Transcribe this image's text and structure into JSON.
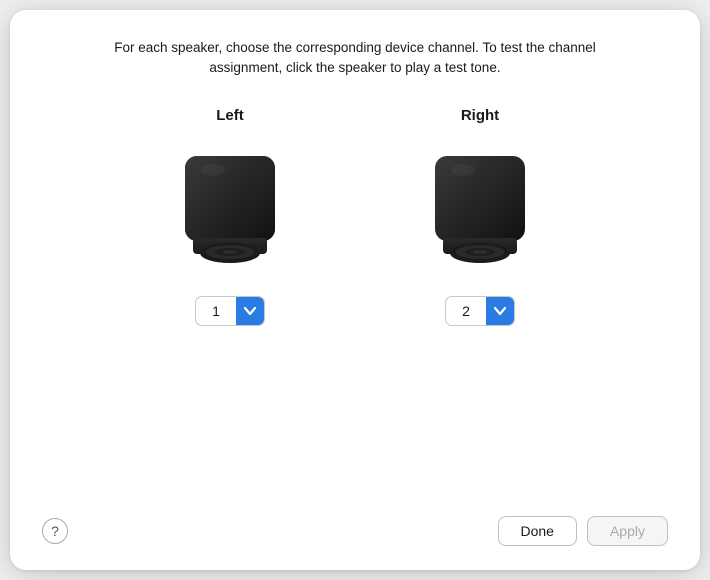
{
  "dialog": {
    "instruction": "For each speaker, choose the corresponding device channel. To test the channel assignment, click the speaker to play a test tone."
  },
  "speakers": [
    {
      "id": "left",
      "label": "Left",
      "channel_value": "1"
    },
    {
      "id": "right",
      "label": "Right",
      "channel_value": "2"
    }
  ],
  "footer": {
    "help_label": "?",
    "done_label": "Done",
    "apply_label": "Apply"
  }
}
